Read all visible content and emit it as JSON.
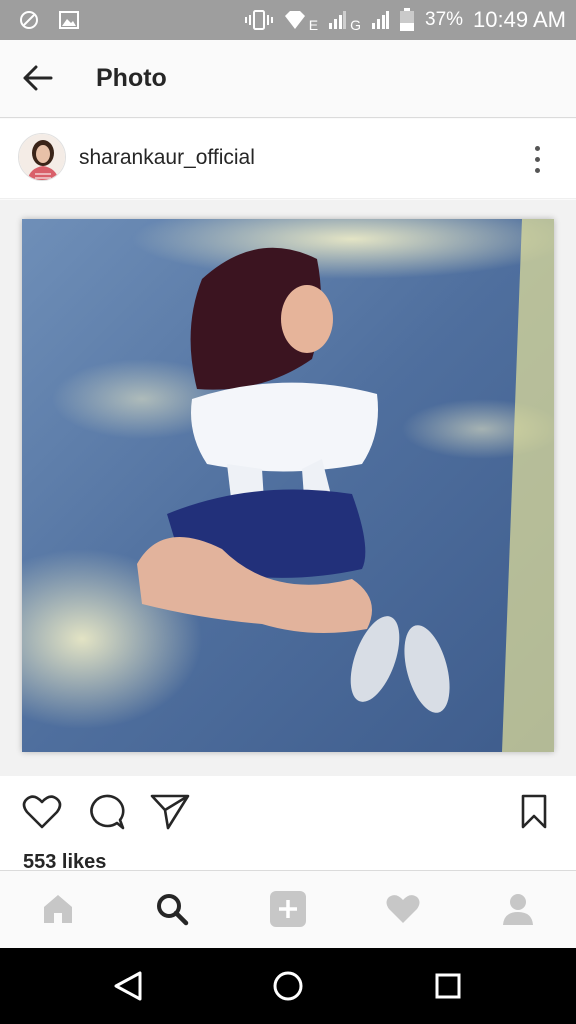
{
  "status_bar": {
    "battery": "37%",
    "time": "10:49 AM",
    "network_1": "E",
    "network_2": "G"
  },
  "header": {
    "title": "Photo"
  },
  "post": {
    "username": "sharankaur_official",
    "likes": "553 likes"
  },
  "icons": {
    "back": "arrow-left-icon",
    "more": "more-vertical-icon",
    "like": "heart-outline-icon",
    "comment": "comment-bubble-icon",
    "share": "paper-plane-icon",
    "save": "bookmark-icon",
    "nav_home": "home-icon",
    "nav_search": "search-icon",
    "nav_add": "add-square-icon",
    "nav_activity": "heart-filled-icon",
    "nav_profile": "profile-icon"
  },
  "colors": {
    "status_bar_bg": "#9e9e9e",
    "text_primary": "#262626",
    "nav_inactive": "#c7c7c7",
    "nav_active": "#262626"
  }
}
